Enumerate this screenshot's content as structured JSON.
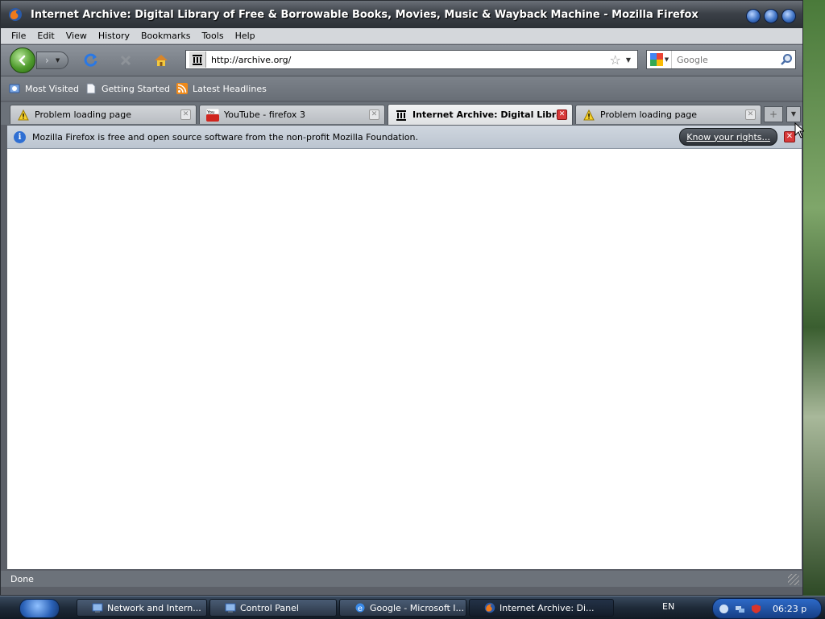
{
  "window": {
    "title": "Internet Archive: Digital Library of Free & Borrowable Books, Movies, Music & Wayback Machine - Mozilla Firefox"
  },
  "menubar": {
    "items": [
      {
        "label": "File",
        "key": "F"
      },
      {
        "label": "Edit",
        "key": "E"
      },
      {
        "label": "View",
        "key": "V"
      },
      {
        "label": "History",
        "key": "H"
      },
      {
        "label": "Bookmarks",
        "key": "B"
      },
      {
        "label": "Tools",
        "key": "T"
      },
      {
        "label": "Help",
        "key": "H"
      }
    ]
  },
  "navbar": {
    "url": "http://archive.org/",
    "search_placeholder": "Google"
  },
  "bookmarks": {
    "items": [
      {
        "label": "Most Visited",
        "icon": "most-visited-icon"
      },
      {
        "label": "Getting Started",
        "icon": "page-icon"
      },
      {
        "label": "Latest Headlines",
        "icon": "rss-icon"
      }
    ]
  },
  "tabs": [
    {
      "label": "Problem loading page",
      "icon": "warning-icon",
      "active": false
    },
    {
      "label": "YouTube - firefox 3",
      "icon": "youtube-icon",
      "active": false
    },
    {
      "label": "Internet Archive: Digital Libra...",
      "icon": "archive-icon",
      "active": true
    },
    {
      "label": "Problem loading page",
      "icon": "warning-icon",
      "active": false
    }
  ],
  "notification": {
    "text": "Mozilla Firefox is free and open source software from the non-profit Mozilla Foundation.",
    "button": "Know your rights..."
  },
  "status": {
    "text": "Done"
  },
  "taskbar": {
    "tasks": [
      {
        "label": "Network and Intern...",
        "icon": "control-panel-icon"
      },
      {
        "label": "Control Panel",
        "icon": "control-panel-icon"
      },
      {
        "label": "Google - Microsoft I...",
        "icon": "ie-icon"
      },
      {
        "label": "Internet Archive: Di...",
        "icon": "firefox-icon"
      }
    ],
    "language": "EN",
    "clock": "06:23 p"
  }
}
